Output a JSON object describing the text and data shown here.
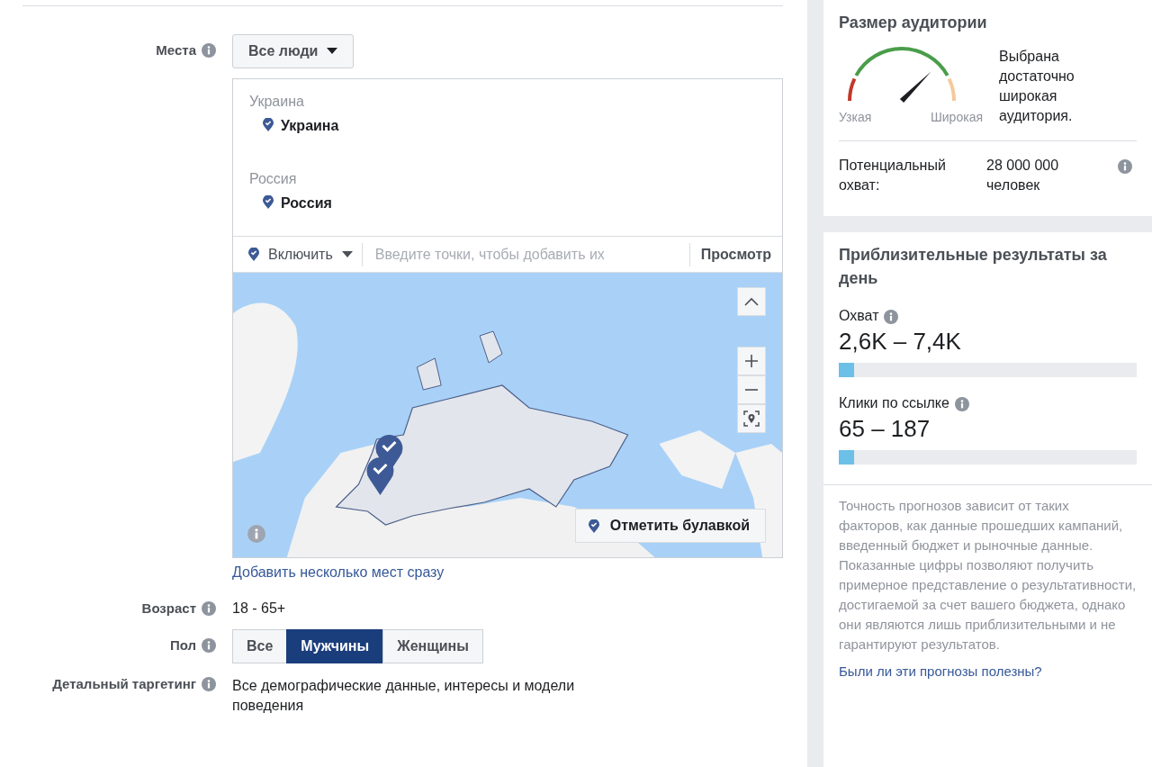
{
  "targeting": {
    "locations": {
      "label": "Места",
      "audience_dropdown": "Все люди",
      "groups": [
        {
          "heading": "Украина",
          "items": [
            "Украина"
          ]
        },
        {
          "heading": "Россия",
          "items": [
            "Россия"
          ]
        }
      ],
      "mode_dropdown": "Включить",
      "search_placeholder": "Введите точки, чтобы добавить их",
      "browse_button": "Просмотр",
      "drop_pin_button": "Отметить булавкой",
      "bulk_link": "Добавить несколько мест сразу"
    },
    "age": {
      "label": "Возраст",
      "value": "18 - 65+"
    },
    "gender": {
      "label": "Пол",
      "options": [
        {
          "label": "Все",
          "selected": false
        },
        {
          "label": "Мужчины",
          "selected": true
        },
        {
          "label": "Женщины",
          "selected": false
        }
      ]
    },
    "detailed": {
      "label": "Детальный таргетинг",
      "value": "Все демографические данные, интересы и модели поведения"
    }
  },
  "audience_size": {
    "title": "Размер аудитории",
    "gauge": {
      "min_label": "Узкая",
      "max_label": "Широкая"
    },
    "verdict": "Выбрана достаточно широкая аудитория.",
    "reach_label": "Потенциальный охват:",
    "reach_value": "28 000 000 человек"
  },
  "estimates": {
    "title": "Приблизительные результаты за день",
    "metrics": [
      {
        "label": "Охват",
        "value": "2,6K – 7,4K",
        "level": 0.05
      },
      {
        "label": "Клики по ссылке",
        "value": "65 – 187",
        "level": 0.05
      }
    ],
    "disclaimer": "Точность прогнозов зависит от таких факторов, как данные прошедших кампаний, введенный бюджет и рыночные данные. Показанные цифры позволяют получить примерное представление о результативности, достигаемой за счет вашего бюджета, однако они являются лишь приблизительными и не гарантируют результатов.",
    "feedback_link": "Были ли эти прогнозы полезны?"
  }
}
